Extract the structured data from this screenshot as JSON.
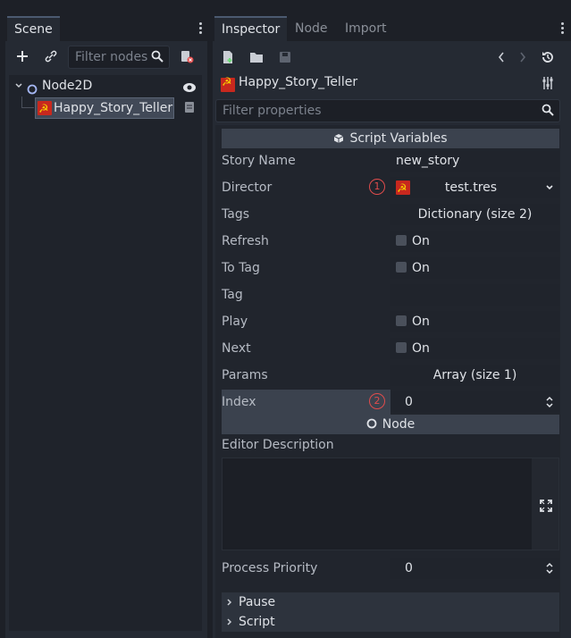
{
  "scene_dock": {
    "tab": "Scene",
    "filter_placeholder": "Filter nodes",
    "nodes": [
      {
        "name": "Node2D"
      },
      {
        "name": "Happy_Story_Teller"
      }
    ]
  },
  "inspector": {
    "tabs": [
      "Inspector",
      "Node",
      "Import"
    ],
    "object_name": "Happy_Story_Teller",
    "filter_placeholder": "Filter properties",
    "section_title": "Script Variables",
    "properties": [
      {
        "label": "Story Name",
        "value": "new_story"
      },
      {
        "label": "Director",
        "value": "test.tres",
        "warning": "1"
      },
      {
        "label": "Tags",
        "value": "Dictionary (size 2)"
      },
      {
        "label": "Refresh",
        "value": "On"
      },
      {
        "label": "To Tag",
        "value": "On"
      },
      {
        "label": "Tag",
        "value": ""
      },
      {
        "label": "Play",
        "value": "On"
      },
      {
        "label": "Next",
        "value": "On"
      },
      {
        "label": "Params",
        "value": "Array (size 1)"
      },
      {
        "label": "Index",
        "value": "0",
        "warning": "2"
      }
    ],
    "node_section": "Node",
    "editor_description_label": "Editor Description",
    "process_priority": {
      "label": "Process Priority",
      "value": "0"
    },
    "groups": [
      "Pause",
      "Script"
    ]
  },
  "colors": {
    "accent": "#4b5a70",
    "warning": "#e04c4c",
    "selection": "#414957"
  }
}
